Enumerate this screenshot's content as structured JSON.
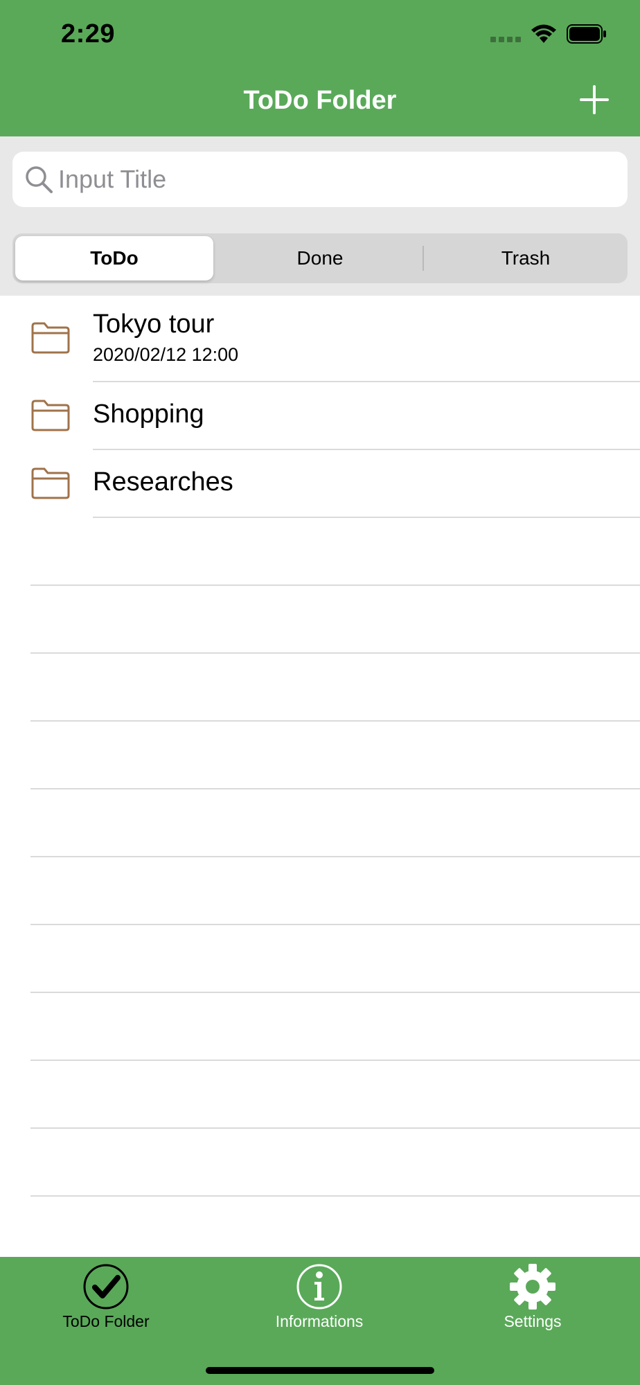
{
  "status_bar": {
    "time": "2:29"
  },
  "nav": {
    "title": "ToDo Folder"
  },
  "search": {
    "placeholder": "Input Title",
    "value": ""
  },
  "segments": [
    {
      "label": "ToDo",
      "selected": true
    },
    {
      "label": "Done",
      "selected": false
    },
    {
      "label": "Trash",
      "selected": false
    }
  ],
  "folders": [
    {
      "title": "Tokyo tour",
      "date": "2020/02/12 12:00"
    },
    {
      "title": "Shopping"
    },
    {
      "title": "Researches"
    }
  ],
  "tabs": [
    {
      "label": "ToDo Folder",
      "icon": "checkmark-circle-icon",
      "active": true
    },
    {
      "label": "Informations",
      "icon": "info-circle-icon",
      "active": false
    },
    {
      "label": "Settings",
      "icon": "gear-icon",
      "active": false
    }
  ],
  "colors": {
    "accent": "#5aa959",
    "folder_icon": "#a0724a",
    "background": "#ffffff",
    "search_background": "#e8e8e8"
  }
}
